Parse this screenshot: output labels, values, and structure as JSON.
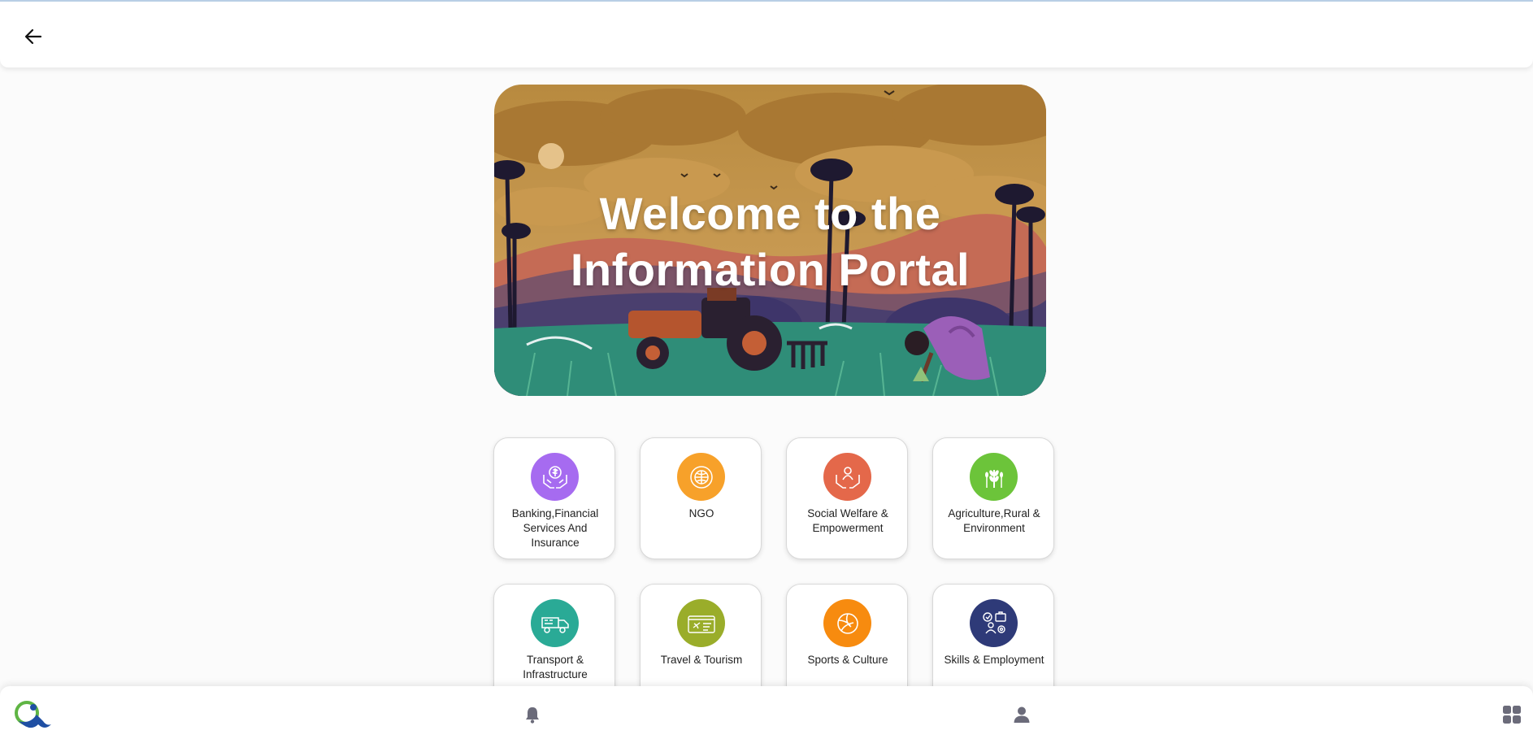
{
  "header": {
    "back_icon": "arrow-left-icon"
  },
  "banner": {
    "title_line1": "Welcome to the",
    "title_line2": "Information Portal"
  },
  "categories": [
    {
      "label": "Banking,Financial Services And Insurance",
      "icon": "hands-dollar-icon",
      "color": "#a66bf0"
    },
    {
      "label": "NGO",
      "icon": "globe-seal-icon",
      "color": "#f7a12a"
    },
    {
      "label": "Social Welfare & Empowerment",
      "icon": "hands-person-icon",
      "color": "#e4684a"
    },
    {
      "label": "Agriculture,Rural & Environment",
      "icon": "wheat-icon",
      "color": "#6cc43a"
    },
    {
      "label": "Transport & Infrastructure",
      "icon": "truck-icon",
      "color": "#2aaa96"
    },
    {
      "label": "Travel & Tourism",
      "icon": "boarding-pass-icon",
      "color": "#9aad2a"
    },
    {
      "label": "Sports & Culture",
      "icon": "volleyball-icon",
      "color": "#f78b0f"
    },
    {
      "label": "Skills & Employment",
      "icon": "person-briefcase-gear-icon",
      "color": "#2e3a78"
    }
  ],
  "bottom_nav": {
    "logo_icon": "app-logo-icon",
    "notifications_icon": "bell-icon",
    "profile_icon": "user-icon",
    "menu_icon": "grid-icon"
  }
}
